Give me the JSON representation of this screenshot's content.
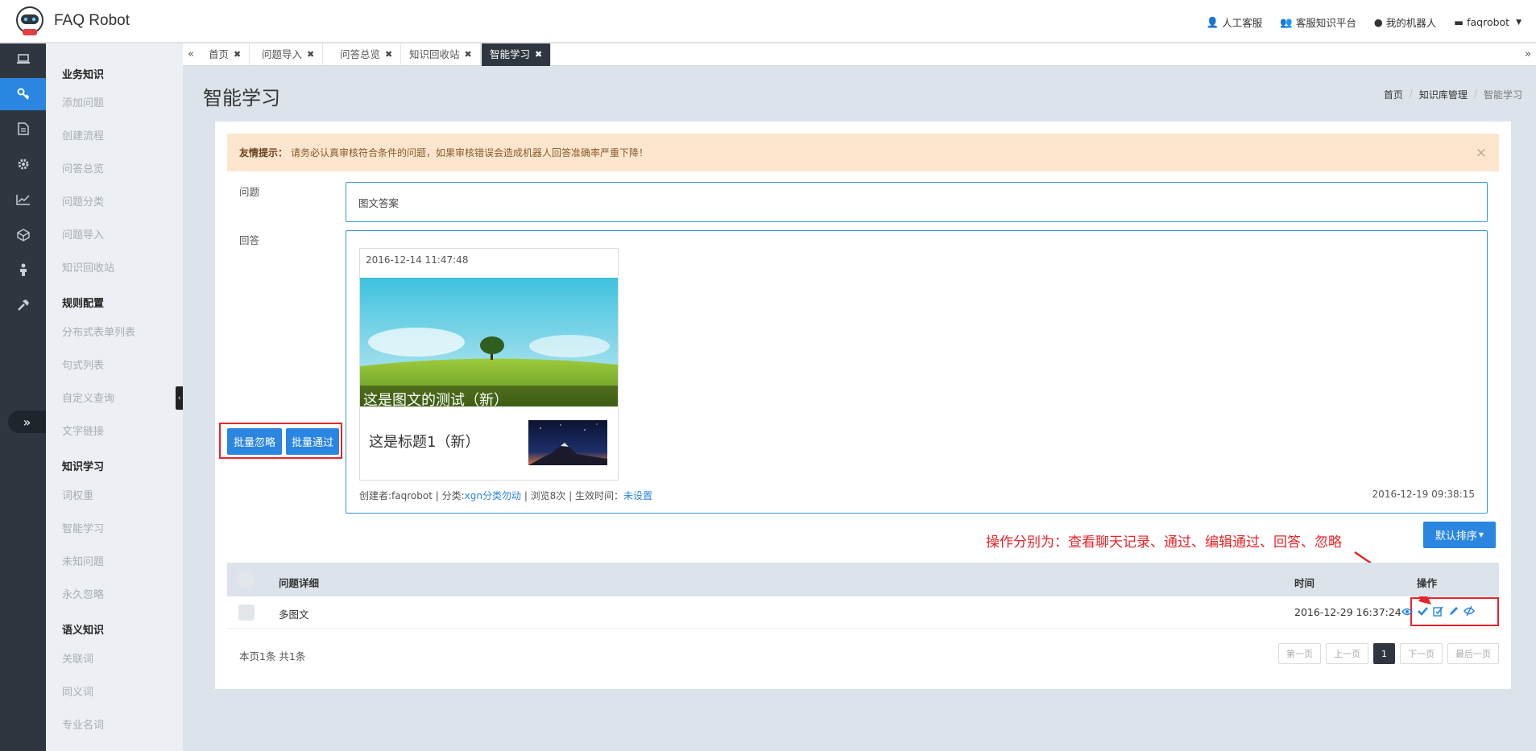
{
  "app": {
    "brand": "FAQ Robot"
  },
  "topnav": [
    {
      "icon": "user-icon",
      "label": "人工客服"
    },
    {
      "icon": "users-icon",
      "label": "客服知识平台"
    },
    {
      "icon": "android-icon",
      "label": "我的机器人"
    },
    {
      "icon": "card-icon",
      "label": "faqrobot"
    }
  ],
  "sidebar": {
    "groups": [
      {
        "title": "业务知识",
        "items": [
          "添加问题",
          "创建流程",
          "问答总览",
          "问题分类",
          "问题导入",
          "知识回收站"
        ]
      },
      {
        "title": "规则配置",
        "items": [
          "分布式表单列表",
          "句式列表",
          "自定义查询",
          "文字链接"
        ]
      },
      {
        "title": "知识学习",
        "items": [
          "词权重",
          "智能学习",
          "未知问题",
          "永久忽略"
        ]
      },
      {
        "title": "语义知识",
        "items": [
          "关联词",
          "同义词",
          "专业名词"
        ]
      }
    ]
  },
  "tabs": [
    "首页",
    "问题导入",
    "问答总览",
    "知识回收站",
    "智能学习"
  ],
  "page": {
    "title": "智能学习",
    "breadcrumb": [
      "首页",
      "知识库管理",
      "智能学习"
    ]
  },
  "alert": {
    "strong": "友情提示：",
    "text": "请务必认真审核符合条件的问题，如果审核错误会造成机器人回答准确率严重下降！",
    "close": "×"
  },
  "form": {
    "question_label": "问题",
    "question_value": "图文答案",
    "answer_label": "回答"
  },
  "news": {
    "date": "2016-12-14 11:47:48",
    "hero_caption": "这是图文的测试（新）",
    "item_title": "这是标题1（新）"
  },
  "meta": {
    "creator": "创建者:faqrobot",
    "category_label": "分类:",
    "category_value": "xgn分类勿动",
    "views": "浏览8次",
    "effective_label": "生效时间：",
    "effective_value": "未设置",
    "time": "2016-12-19 09:38:15"
  },
  "actions": {
    "batch_ignore": "批量忽略",
    "batch_pass": "批量通过",
    "sort": "默认排序",
    "annotation": "操作分别为：查看聊天记录、通过、编辑通过、回答、忽略"
  },
  "table": {
    "headers": {
      "detail": "问题详细",
      "time": "时间",
      "ops": "操作"
    },
    "rows": [
      {
        "detail": "多图文",
        "time": "2016-12-29 16:37:24"
      }
    ],
    "op_icons": [
      "eye-icon",
      "check-icon",
      "edit-check-icon",
      "pencil-icon",
      "ignore-icon"
    ]
  },
  "pagination": {
    "info": "本页1条 共1条",
    "first": "第一页",
    "prev": "上一页",
    "current": "1",
    "next": "下一页",
    "last": "最后一页"
  },
  "colors": {
    "accent": "#2a86e0",
    "rail": "#2f3640",
    "annotation": "#e8242a"
  }
}
